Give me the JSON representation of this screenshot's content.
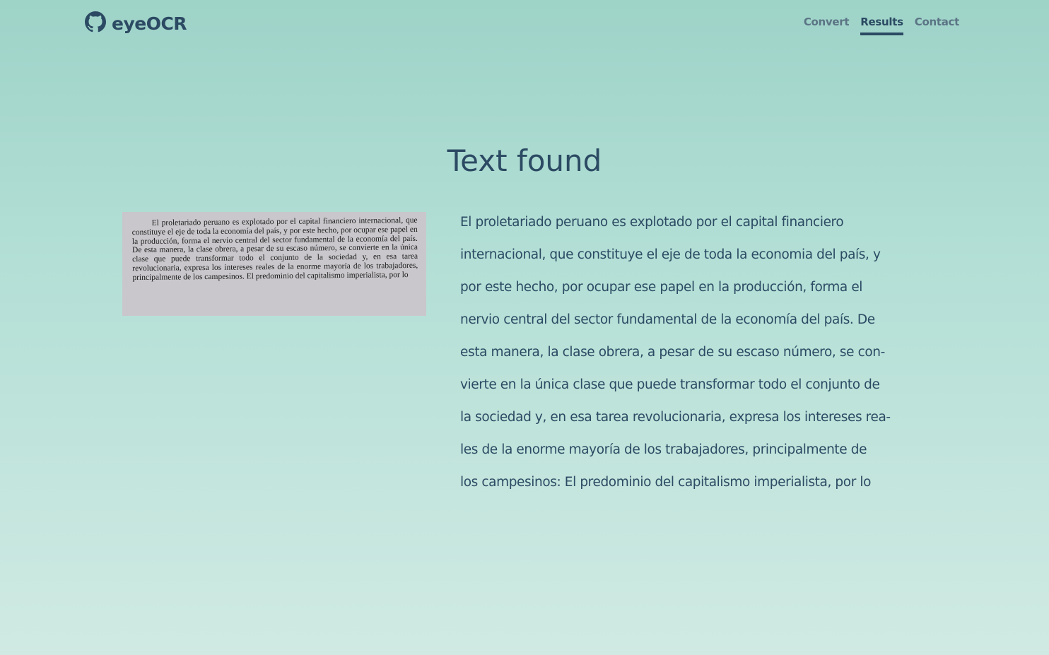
{
  "header": {
    "brand": "eyeOCR",
    "nav": [
      {
        "label": "Convert",
        "active": false
      },
      {
        "label": "Results",
        "active": true
      },
      {
        "label": "Contact",
        "active": false
      }
    ]
  },
  "main": {
    "title": "Text found",
    "scan_text": "El proletariado peruano es explotado por el capital financiero internacional, que constituye el eje de toda la economía del país, y por este hecho, por ocupar ese papel en la producción, forma el nervio central del sector fundamental de la economía del país. De esta manera, la clase obrera, a pesar de su escaso número, se convierte en la única clase que puede transformar todo el conjunto de la sociedad y, en esa tarea revolucionaria, expresa los intereses reales de la enorme mayoría de los trabajadores, principalmente de los campesinos. El predominio del capitalismo imperialista, por lo",
    "result_lines": [
      "El proletariado peruano es explotado por el capital financiero",
      "internacional, que constituye el eje de toda la economia del país, y",
      "por este hecho, por ocupar ese papel en la producción, forma el",
      "nervio central del sector fundamental de la economía del país. De",
      "esta manera, la clase obrera, a pesar de su escaso número, se con-",
      "vierte en la única clase que puede transformar todo el conjunto de",
      "la sociedad y, en esa tarea revolucionaria, expresa los intereses rea-",
      "les de la enorme mayoría de los trabajadores, principalmente de",
      "los campesinos: El predominio del capitalismo imperialista, por lo"
    ]
  },
  "colors": {
    "text": "#2c4a63",
    "nav_inactive": "#5b7485",
    "background_top": "#9ed3c8",
    "background_bottom": "#d0eae3",
    "scan_paper": "#c9c7cb"
  },
  "icons": {
    "brand": "github-icon"
  }
}
